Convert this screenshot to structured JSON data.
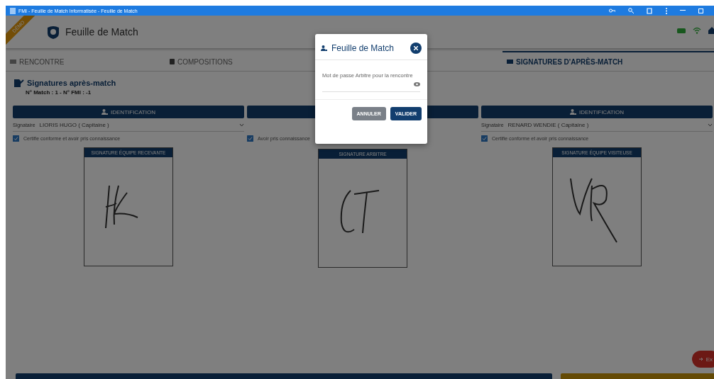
{
  "window": {
    "title": "FMI - Feuille de Match Informatisée - Feuille de Match"
  },
  "header": {
    "ribbon": "DÉMO",
    "title": "Feuille de Match"
  },
  "tabs": [
    {
      "label": "RENCONTRE",
      "selected": false
    },
    {
      "label": "COMPOSITIONS",
      "selected": false
    },
    {
      "label": "SIGNATURES D'APRÈS-MATCH",
      "selected": true
    }
  ],
  "page": {
    "title": "Signatures après-match",
    "subtitle": "N° Match : 1 - N° FMI : -1"
  },
  "columns": [
    {
      "button": "IDENTIFICATION",
      "signatory_label": "Signataire",
      "signatory": "LIORIS HUGO ( Capitaine )",
      "checkbox": {
        "label": "Certifie conforme et avoir pris connaissance",
        "checked": true
      },
      "box_title": "SIGNATURE ÉQUIPE RECEVANTE",
      "kind": "hl"
    },
    {
      "checkbox": {
        "label": "Avoir pris connaissance",
        "checked": true
      },
      "box_title": "SIGNATURE ARBITRE",
      "kind": "ct"
    },
    {
      "button": "IDENTIFICATION",
      "signatory_label": "Signataire",
      "signatory": "RENARD WENDIE ( Capitaine )",
      "checkbox": {
        "label": "Certifie conforme et avoir pris connaissance",
        "checked": true
      },
      "box_title": "SIGNATURE ÉQUIPE VISITEUSE",
      "kind": "vr"
    }
  ],
  "bottom_buttons": [
    {
      "kind": "navy"
    },
    {
      "kind": "gold"
    }
  ],
  "exit_button": {
    "label": "Ex"
  },
  "dialog": {
    "title": "Feuille de Match",
    "field": {
      "label": "Mot de passe Arbitre pour la rencontre"
    },
    "buttons": [
      {
        "label": "ANNULER",
        "kind": "secondary"
      },
      {
        "label": "VALIDER",
        "kind": "primary"
      }
    ]
  }
}
